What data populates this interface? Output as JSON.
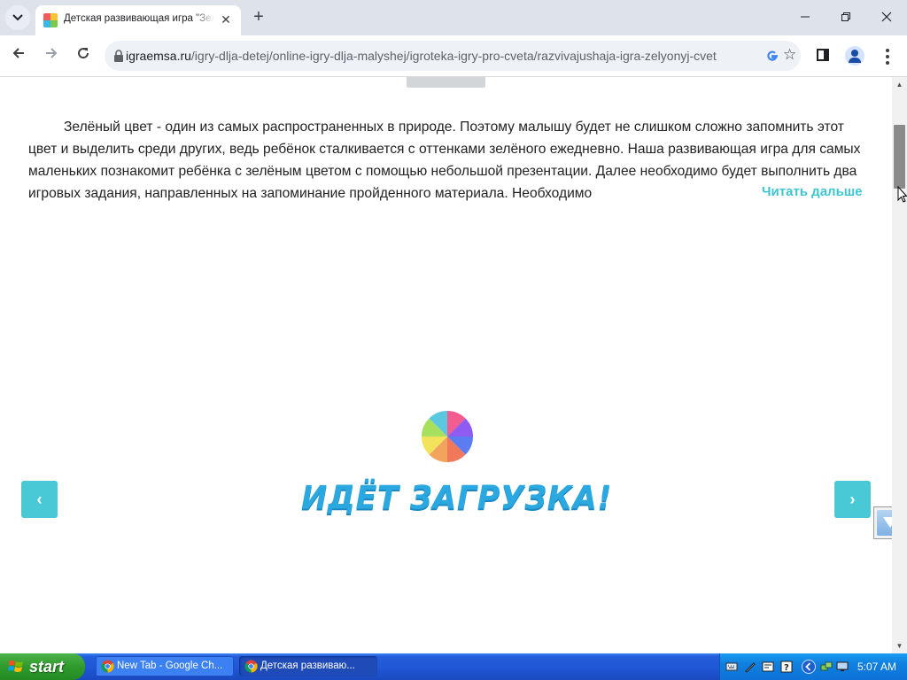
{
  "browser": {
    "tab": {
      "title": "Детская развивающая игра \"Зеленый цвет\""
    },
    "url": {
      "domain": "igraemsa.ru",
      "path": "/igry-dlja-detej/online-igry-dlja-malyshej/igroteka-igry-pro-cveta/razvivajushaja-igra-zelyonyj-cvet"
    }
  },
  "page": {
    "description": "Зелёный цвет - один из самых распространенных в природе. Поэтому малышу будет не слишком сложно запомнить этот цвет и выделить среди других, ведь ребёнок сталкивается с оттенками зелёного ежедневно. Наша развивающая игра для самых маленьких познакомит ребёнка с зелёным цветом с помощью небольшой презентации. Далее необходимо будет выполнить два игровых задания, направленных на запоминание пройденного материала. Необходимо",
    "read_more": "Читать дальше",
    "loading": "ИДЁТ ЗАГРУЗКА!",
    "prev_arrow": "‹",
    "next_arrow": "›"
  },
  "taskbar": {
    "start_label": "start",
    "tasks": [
      {
        "label": "New Tab - Google Ch..."
      },
      {
        "label": "Детская развиваю..."
      }
    ],
    "clock": "5:07 AM"
  },
  "colors": {
    "accent": "#3ec7d1",
    "loading_text": "#2ba8e0",
    "slider_arrow": "#49c8d6"
  }
}
